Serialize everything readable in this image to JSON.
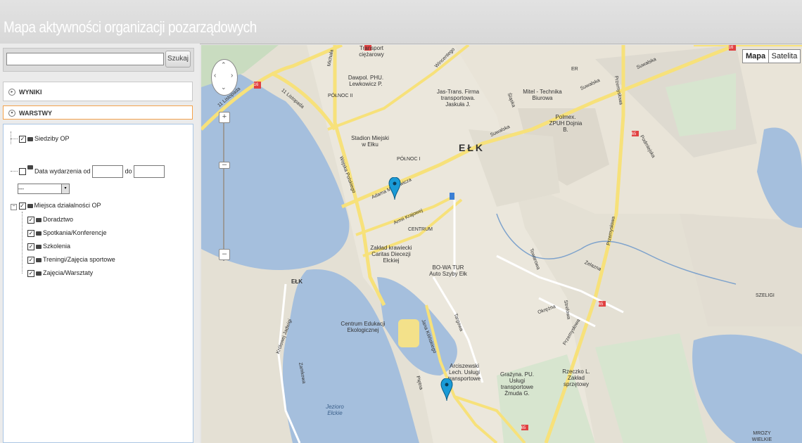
{
  "app": {
    "title": "Mapa aktywności organizacji pozarządowych"
  },
  "search": {
    "value": "",
    "placeholder": "",
    "button_label": "Szukaj"
  },
  "panels": {
    "results_label": "WYNIKI",
    "layers_label": "WARSTWY"
  },
  "layers": {
    "siedziby": "Siedziby OP",
    "date_label": "Data wydarzenia od",
    "date_to": "do",
    "select_value": "---",
    "miejsca": "Miejsca działalności OP",
    "children": [
      "Doradztwo",
      "Spotkania/Konferencje",
      "Szkolenia",
      "Treningi/Zajęcia sportowe",
      "Zajęcia/Warsztaty"
    ]
  },
  "map_controls": {
    "map_btn": "Mapa",
    "satellite_btn": "Satelita",
    "zoom_in": "+",
    "zoom_out": "–"
  },
  "map_labels": {
    "city": "EŁK",
    "elk_left": "EŁK",
    "polnoc_ii": "PÓŁNOC II",
    "polnoc_i": "PÓŁNOC I",
    "centrum": "CENTRUM",
    "szeligi": "SZELIGI",
    "mrozy": "MROZY WIELKIE",
    "stadion": "Stadion Miejski w Ełku",
    "dawpol": "Dawpol. PHU. Lewkowicz P.",
    "transport": "Transport ciężarowy",
    "jastrans": "Jas-Trans. Firma transportowa. Jaskuła J.",
    "mitel": "Mitel - Technika Biurowa",
    "polmex": "Polmex. ZPUH Dojnia B.",
    "zaklad": "Zakład krawiecki Caritas Diecezji Ełckiej",
    "bowa": "BO-WA TUR Auto Szyby Ełk",
    "centrum_edu": "Centrum Edukacji Ekologicznej",
    "arciszewski": "Arciszewski Lech. Usługi transportowe",
    "grazyna": "Grażyna. PU. Usługi transportowe Żmuda G.",
    "rzeczko": "Rzeczko L. Zakład sprzętowy",
    "jezioro": "Jezioro Ełckie",
    "street_11listopada_a": "11 Listopada",
    "street_11listopada_b": "11 Listopada",
    "street_michala": "Michała",
    "street_wincentego": "Wincentego",
    "street_suwalska_a": "Suwalska",
    "street_suwalska_b": "Suwalska",
    "street_suwalska_c": "Suwalska",
    "street_przemyslowa_a": "Przemysłowa",
    "street_przemyslowa_b": "Przemysłowa",
    "street_przemyslowa_c": "Przemysłowa",
    "street_wojska": "Wojska Polskiego",
    "street_adama": "Adama Mickiewicza",
    "street_armii": "Armii Krajowej",
    "street_jana": "Jana Kilińskiego",
    "street_targowa": "Targowa",
    "street_okrezna": "Okrężna",
    "street_zelazna": "Żelazna",
    "street_towarowa": "Towarowa",
    "street_strefowa": "Strefowa",
    "street_krolowej": "Królowej Jadwigi",
    "street_zamkowa": "Zamkowa",
    "street_pietna": "Piętna",
    "street_slaska": "Śląska",
    "street_podmiejska": "Podmiejska",
    "er": "ER",
    "r16a": "16",
    "r16b": "16",
    "r65a": "65",
    "r65b": "65",
    "r65c": "65"
  }
}
